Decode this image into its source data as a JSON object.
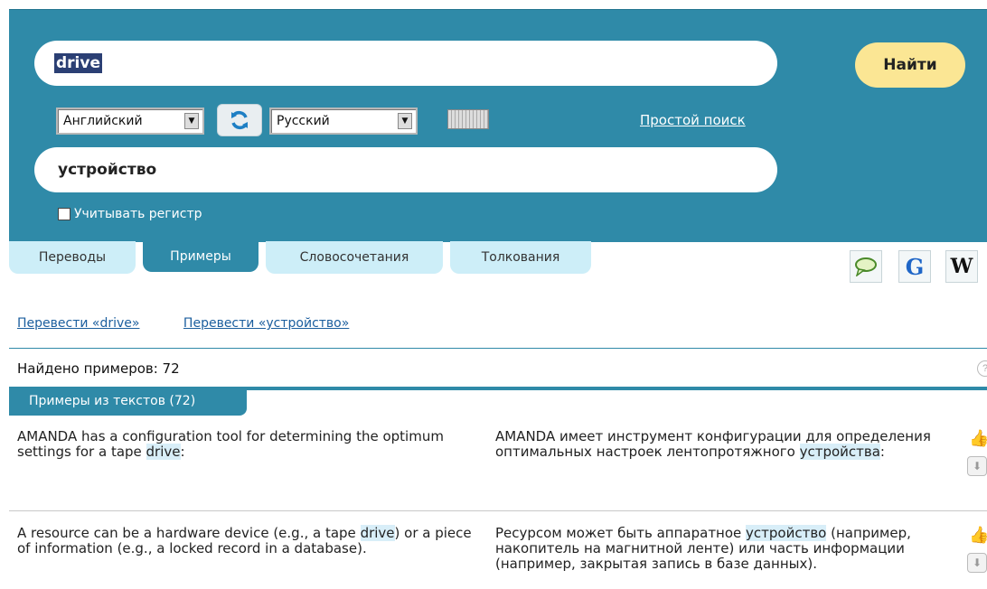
{
  "search": {
    "query": "drive",
    "button": "Найти"
  },
  "languages": {
    "from": "Английский",
    "to": "Русский",
    "simple_search": "Простой поиск"
  },
  "translation": {
    "value": "устройство",
    "case_label": "Учитывать регистр"
  },
  "tabs": [
    "Переводы",
    "Примеры",
    "Словосочетания",
    "Толкования"
  ],
  "ext_icons": [
    "G",
    "W"
  ],
  "links": [
    "Перевести «drive»",
    "Перевести «устройство»"
  ],
  "found": "Найдено примеров: 72",
  "subtab": "Примеры из текстов (72)",
  "examples": [
    {
      "src_before": "AMANDA has a configuration tool for determining the optimum settings for a tape ",
      "src_hl": "drive",
      "src_after": ":",
      "dst_before": "AMANDA имеет инструмент конфигурации для определения оптимальных настроек лентопротяжного ",
      "dst_hl": "устройства",
      "dst_after": ":"
    },
    {
      "src_before": "A resource can be a hardware device (e.g., a tape ",
      "src_hl": "drive",
      "src_after": ") or a piece of information (e.g., a locked record in a database).",
      "dst_before": "Ресурсом может быть аппаратное ",
      "dst_hl": "устройство",
      "dst_after": " (например, накопитель на магнитной ленте) или часть информации (например, закрытая запись в базе данных)."
    }
  ],
  "colors": {
    "header": "#2f8aa8",
    "find_button": "#fbe694",
    "highlight": "#d8eef8",
    "tab_inactive": "#cdeef8"
  }
}
